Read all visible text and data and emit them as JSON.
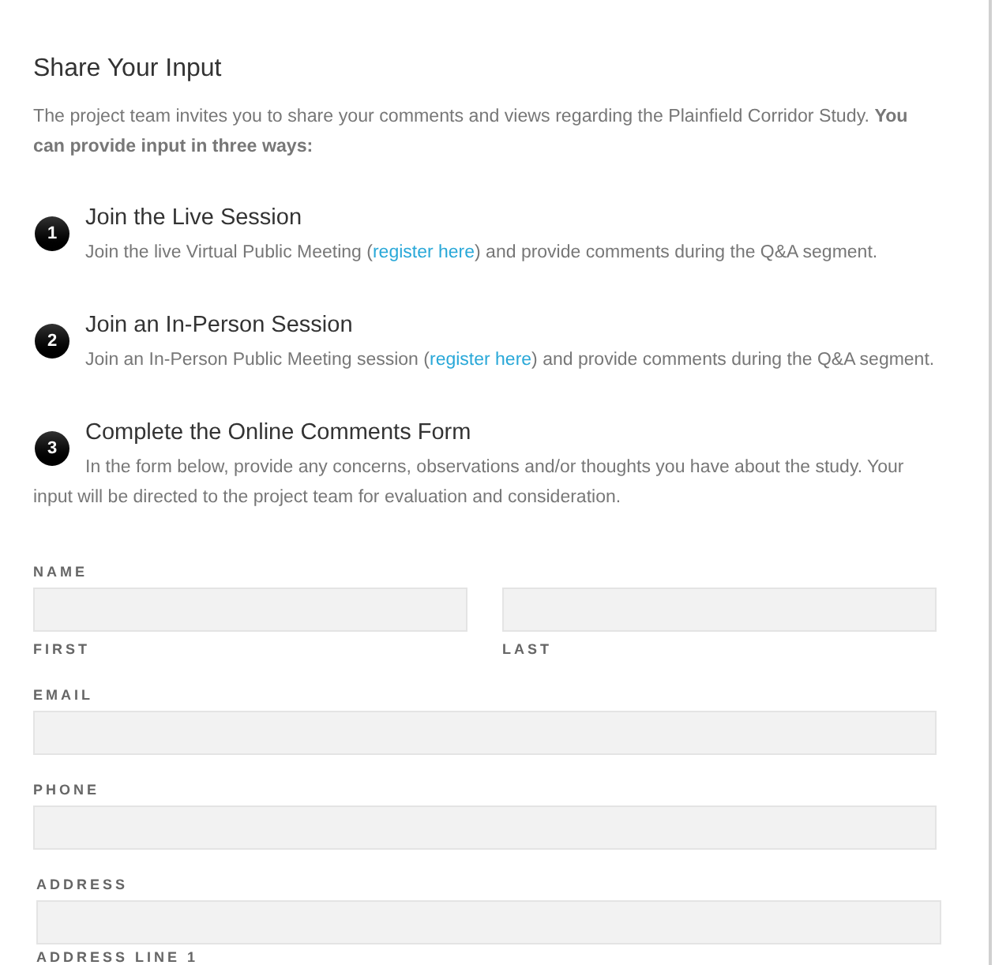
{
  "title": "Share Your Input",
  "intro": "The project team invites you to share your comments and views regarding the Plainfield Corridor Study. **You can provide input in three ways:**",
  "steps": [
    {
      "number": "1",
      "title": "Join the Live Session",
      "before": "Join the live Virtual Public Meeting (",
      "link": "register here",
      "after": ") and provide comments during the Q&A segment."
    },
    {
      "number": "2",
      "title": "Join an In-Person Session",
      "before": "Join an In-Person Public Meeting session (",
      "link": "register here",
      "after": ") and provide comments during the Q&A segment."
    },
    {
      "number": "3",
      "title": "Complete the Online Comments Form",
      "before": "In the form below, provide any concerns, observations and/or thoughts you have about the study. Your input will be directed to the project team for evaluation and consideration."
    }
  ],
  "fields": [
    {
      "kind": "name",
      "label": "NAME",
      "parts": [
        "FIRST",
        "LAST"
      ]
    },
    {
      "kind": "text",
      "label": "EMAIL"
    },
    {
      "kind": "text",
      "label": "PHONE"
    },
    {
      "kind": "address",
      "label": "ADDRESS",
      "sublabel": "ADDRESS LINE 1"
    }
  ]
}
